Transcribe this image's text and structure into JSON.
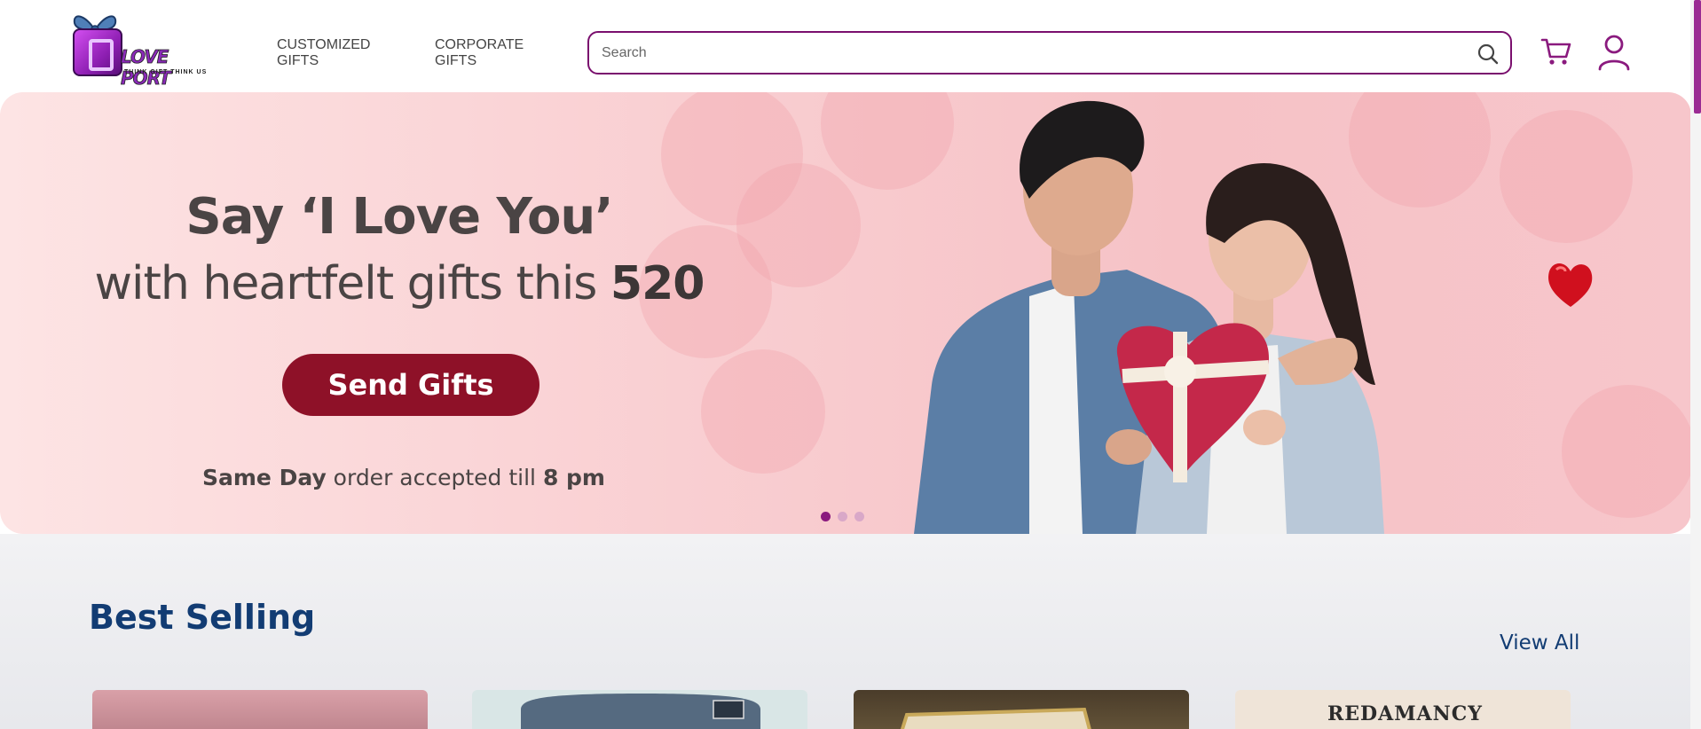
{
  "brand": {
    "name": "LOVE PORT",
    "tagline": "THINK GIFT THINK US"
  },
  "nav": {
    "items": [
      {
        "label": "CUSTOMIZED GIFTS"
      },
      {
        "label": "CORPORATE GIFTS"
      }
    ]
  },
  "search": {
    "placeholder": "Search",
    "value": ""
  },
  "icons": {
    "search": "search-icon",
    "cart": "cart-icon",
    "user": "user-icon"
  },
  "hero": {
    "title_line1": "Say ‘I Love You’",
    "title_line2_prefix": "with heartfelt gifts this ",
    "title_line2_bold": "520",
    "cta_label": "Send Gifts",
    "sub_bold1": "Same Day",
    "sub_mid": " order accepted till ",
    "sub_bold2": "8 pm",
    "slides": 3,
    "active_slide": 1
  },
  "best_selling": {
    "title": "Best Selling",
    "view_all": "View All",
    "product_card_text": [
      "",
      "",
      "",
      "REDAMANCY"
    ]
  },
  "colors": {
    "accent": "#7a0f6e",
    "cta": "#8e1128",
    "heading": "#123c73"
  }
}
